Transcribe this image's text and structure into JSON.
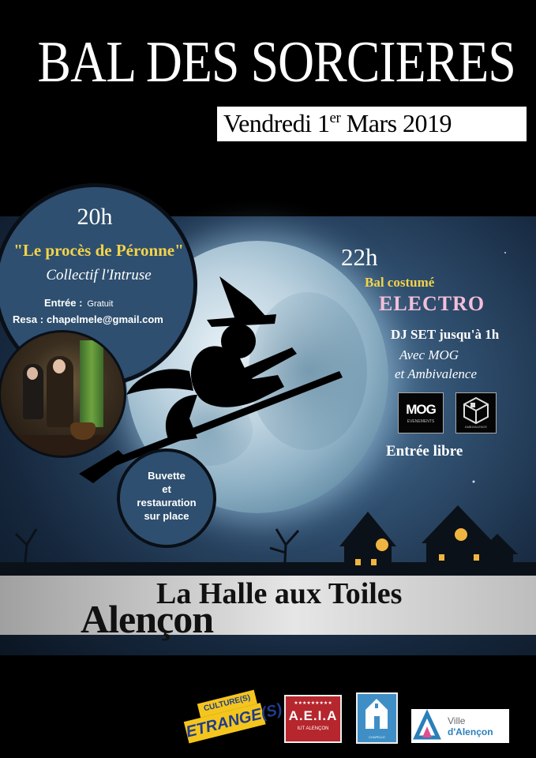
{
  "title": "BAL DES SORCIERES",
  "date": {
    "prefix": "Vendredi 1",
    "superscript": "er",
    "suffix": " Mars 2019"
  },
  "show": {
    "time": "20h",
    "name": "\"Le procès de Péronne\"",
    "company": "Collectif l'Intruse",
    "entree_label": "Entrée :",
    "entree_value": "Gratuit",
    "resa_label": "Resa :",
    "resa_value": "chapelmele@gmail.com"
  },
  "buvette": [
    "Buvette",
    "et",
    "restauration",
    "sur place"
  ],
  "party": {
    "time": "22h",
    "line1": "Bal costumé",
    "line2": "ELECTRO",
    "line3": "DJ SET jusqu'à 1h",
    "line4": "Avec MOG",
    "line5": "et Ambivalence",
    "entry": "Entrée libre"
  },
  "dj_logos": {
    "mog": "MOG",
    "mog_sub": "EVENEMENTS",
    "ambivalence_sub": "AMBIVALENCE"
  },
  "venue": {
    "name": "La Halle aux Toiles",
    "city": "Alençon"
  },
  "partners": {
    "culture_top": "CULTURE(S)",
    "culture_main": "ETRANGE(S)",
    "aeia_title": "A.E.I.A",
    "aeia_stars": "★★★★★★★★★",
    "aeia_sub": "IUT ALENÇON",
    "chapel_sub": "CHAPELLE",
    "ville_line1": "Ville",
    "ville_line2": "d'Alençon"
  },
  "colors": {
    "background": "#000000",
    "accent_yellow": "#f3d34a",
    "accent_pink": "#f4bfd9",
    "circle_blue": "#2e4f6f",
    "aeia_red": "#b6262d",
    "chapel_blue": "#3f8fc6"
  }
}
